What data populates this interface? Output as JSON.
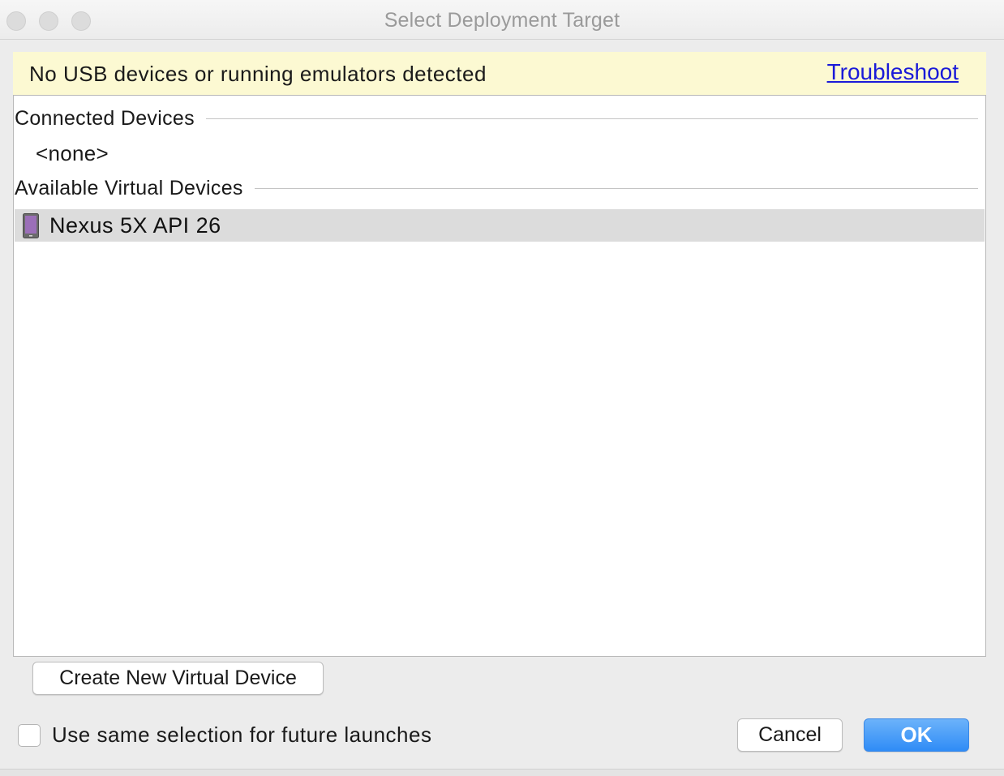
{
  "window": {
    "title": "Select Deployment Target"
  },
  "banner": {
    "message": "No USB devices or running emulators detected",
    "link_label": "Troubleshoot",
    "background_color": "#fcf9d2"
  },
  "device_list": {
    "connected_header": "Connected Devices",
    "connected_empty": "<none>",
    "available_header": "Available Virtual Devices",
    "available_devices": [
      {
        "name": "Nexus 5X API 26",
        "icon": "phone-device-icon",
        "selected": true
      }
    ]
  },
  "actions": {
    "create_label": "Create New Virtual Device",
    "remember_label": "Use same selection for future launches",
    "remember_checked": false,
    "cancel_label": "Cancel",
    "ok_label": "OK",
    "ok_color": "#2f8cf6"
  }
}
